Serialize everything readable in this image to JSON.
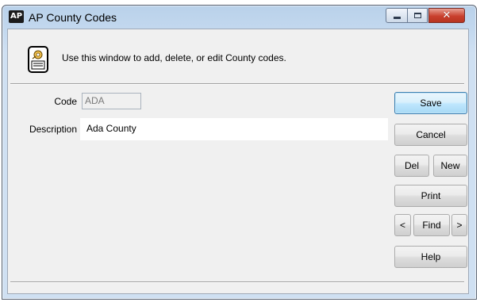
{
  "window": {
    "app_badge": "AP",
    "title": "AP County Codes",
    "controls": {
      "minimize_icon": "minimize-icon",
      "maximize_icon": "maximize-icon",
      "close_icon": "close-icon",
      "close_glyph": "✕"
    }
  },
  "info": {
    "icon": "document-gear-icon",
    "text": "Use this window to add, delete, or edit County codes."
  },
  "form": {
    "code_label": "Code",
    "code_value": "ADA",
    "description_label": "Description",
    "description_value": "Ada County"
  },
  "buttons": {
    "save": "Save",
    "cancel": "Cancel",
    "del": "Del",
    "new": "New",
    "print": "Print",
    "prev": "<",
    "find": "Find",
    "next": ">",
    "help": "Help"
  },
  "colors": {
    "title_bar": "#b9d1ea",
    "close_button": "#c9402e",
    "default_button_border": "#3c7fb1"
  }
}
